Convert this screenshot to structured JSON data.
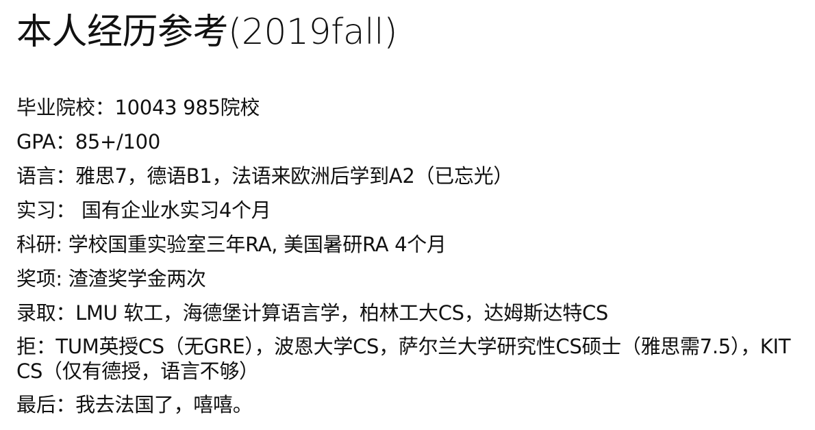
{
  "title": "本人经历参考(2019fall)",
  "lines": [
    "毕业院校：10043 985院校",
    "GPA：85+/100",
    "语言：雅思7，德语B1，法语来欧洲后学到A2（已忘光）",
    "实习： 国有企业水实习4个月",
    "科研: 学校国重实验室三年RA, 美国暑研RA 4个月",
    "奖项: 渣渣奖学金两次",
    "录取：LMU 软工，海德堡计算语言学，柏林工大CS，达姆斯达特CS",
    "拒：TUM英授CS（无GRE），波恩大学CS，萨尔兰大学研究性CS硕士（雅思需7.5），KIT CS（仅有德授，语言不够）",
    "最后：我去法国了，嘻嘻。"
  ]
}
